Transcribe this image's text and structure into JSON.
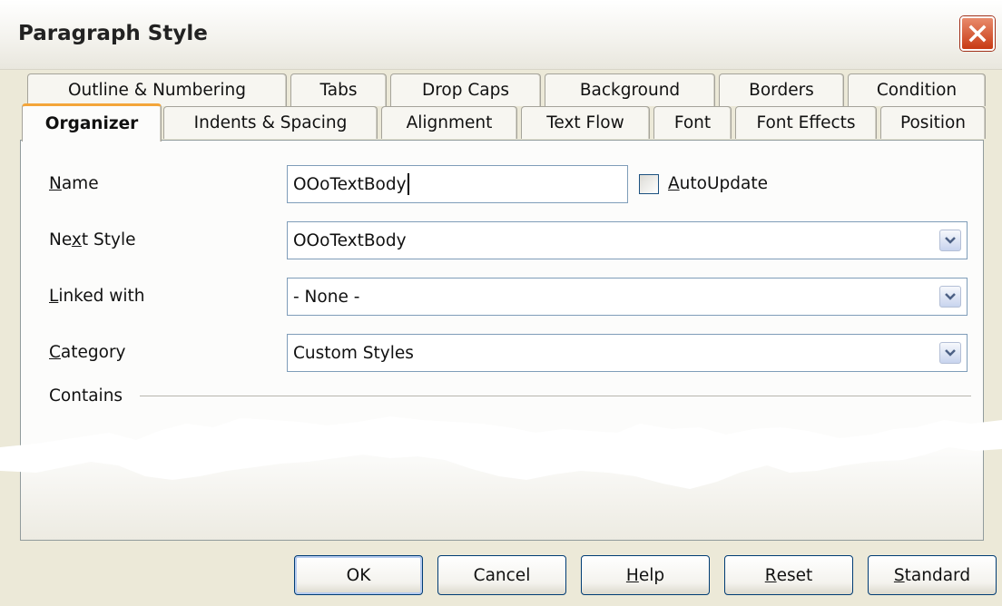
{
  "window": {
    "title": "Paragraph Style",
    "close_icon": "close-icon"
  },
  "tabs": {
    "row1": [
      {
        "id": "outline-numbering",
        "label": "Outline & Numbering"
      },
      {
        "id": "tabs",
        "label": "Tabs"
      },
      {
        "id": "drop-caps",
        "label": "Drop Caps"
      },
      {
        "id": "background",
        "label": "Background"
      },
      {
        "id": "borders",
        "label": "Borders"
      },
      {
        "id": "condition",
        "label": "Condition"
      }
    ],
    "row2": [
      {
        "id": "organizer",
        "label": "Organizer",
        "active": true
      },
      {
        "id": "indents-spacing",
        "label": "Indents & Spacing"
      },
      {
        "id": "alignment",
        "label": "Alignment"
      },
      {
        "id": "text-flow",
        "label": "Text Flow"
      },
      {
        "id": "font",
        "label": "Font"
      },
      {
        "id": "font-effects",
        "label": "Font Effects"
      },
      {
        "id": "position",
        "label": "Position"
      }
    ]
  },
  "organizer": {
    "name": {
      "mnemonic": "N",
      "label_rest": "ame",
      "value": "OOoTextBody"
    },
    "autoupdate": {
      "mnemonic": "A",
      "label_rest": "utoUpdate",
      "checked": false
    },
    "next_style": {
      "label_pre": "Ne",
      "mnemonic": "x",
      "label_post": "t Style",
      "value": "OOoTextBody"
    },
    "linked_with": {
      "mnemonic": "L",
      "label_rest": "inked with",
      "value": "- None -"
    },
    "category": {
      "mnemonic": "C",
      "label_rest": "ategory",
      "value": "Custom Styles"
    },
    "contains": {
      "label": "Contains"
    }
  },
  "buttons": {
    "ok": {
      "label": "OK"
    },
    "cancel": {
      "label": "Cancel"
    },
    "help": {
      "mnemonic": "H",
      "label_rest": "elp"
    },
    "reset": {
      "mnemonic": "R",
      "label_rest": "eset"
    },
    "standard": {
      "mnemonic": "S",
      "label_rest": "tandard"
    }
  },
  "colors": {
    "dialog_bg": "#ece9d8",
    "active_tab_accent": "#f3a53a",
    "close_button": "#c83a14",
    "field_border": "#7f9db9"
  }
}
